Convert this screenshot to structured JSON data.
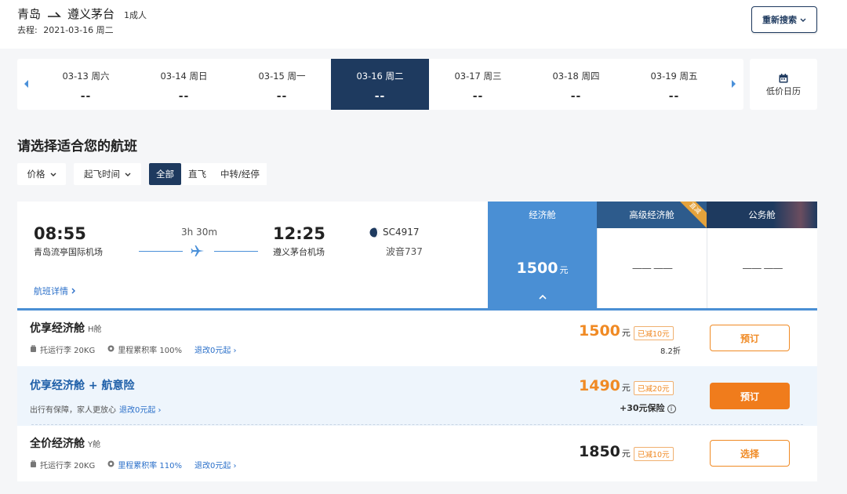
{
  "header": {
    "origin": "青岛",
    "destination": "遵义茅台",
    "passengers": "1成人",
    "trip_label": "去程:",
    "trip_date": "2021-03-16 周二",
    "research_label": "重新搜索"
  },
  "datebar": {
    "dates": [
      {
        "date": "03-13 周六",
        "price": "--"
      },
      {
        "date": "03-14 周日",
        "price": "--"
      },
      {
        "date": "03-15 周一",
        "price": "--"
      },
      {
        "date": "03-16 周二",
        "price": "--",
        "active": true
      },
      {
        "date": "03-17 周三",
        "price": "--"
      },
      {
        "date": "03-18 周四",
        "price": "--"
      },
      {
        "date": "03-19 周五",
        "price": "--"
      }
    ],
    "calendar_label": "低价日历"
  },
  "section_title": "请选择适合您的航班",
  "filters": {
    "price_label": "价格",
    "time_label": "起飞时间",
    "segments": [
      "全部",
      "直飞",
      "中转/经停"
    ],
    "active_segment": "全部"
  },
  "flight": {
    "dep_time": "08:55",
    "dep_airport": "青岛流亭国际机场",
    "duration": "3h 30m",
    "arr_time": "12:25",
    "arr_airport": "遵义茅台机场",
    "flight_no": "SC4917",
    "aircraft": "波音737",
    "detail_link": "航班详情"
  },
  "cabins": {
    "economy": "经济舱",
    "premium": "高级经济舱",
    "business": "公务舱",
    "premium_badge": "直减",
    "economy_price": "1500",
    "currency_unit": "元",
    "empty_placeholder": "—— ——"
  },
  "fares": [
    {
      "name": "优享经济舱",
      "class_code": "H舱",
      "baggage": "托运行李 20KG",
      "mileage": "里程累积率 100%",
      "change": "退改0元起",
      "price": "1500",
      "discount": "已减10元",
      "note": "8.2折",
      "button": "预订"
    },
    {
      "name": "优享经济舱 + 航意险",
      "tagline": "出行有保障，家人更放心",
      "change": "退改0元起",
      "price": "1490",
      "discount": "已减20元",
      "note": "+30元保险",
      "button": "预订"
    },
    {
      "name": "全价经济舱",
      "class_code": "Y舱",
      "baggage": "托运行李 20KG",
      "mileage": "里程累积率 110%",
      "change": "退改0元起",
      "price": "1850",
      "discount": "已减10元",
      "button": "选择"
    }
  ],
  "colors": {
    "navy": "#1e3a5f",
    "blue": "#4a8fd4",
    "orange": "#f08a24",
    "link": "#2a6fc9"
  }
}
